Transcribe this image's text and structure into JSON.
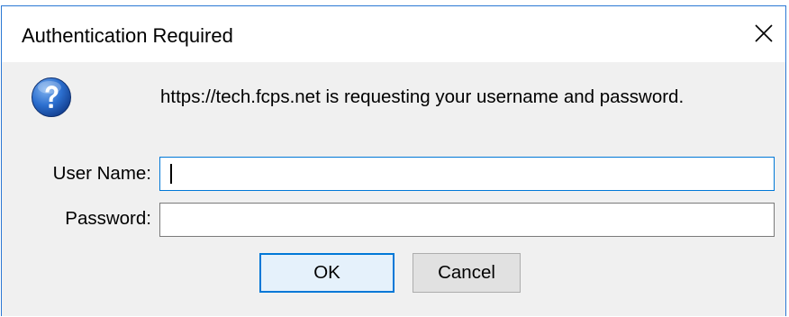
{
  "dialog": {
    "title": "Authentication Required",
    "close_icon": "close-icon",
    "accent_color": "#0078d7"
  },
  "prompt": {
    "icon": "question-icon",
    "message": "https://tech.fcps.net is requesting your username and password."
  },
  "form": {
    "username": {
      "label": "User Name:",
      "value": "",
      "placeholder": ""
    },
    "password": {
      "label": "Password:",
      "value": "",
      "placeholder": ""
    }
  },
  "buttons": {
    "ok_label": "OK",
    "cancel_label": "Cancel"
  }
}
